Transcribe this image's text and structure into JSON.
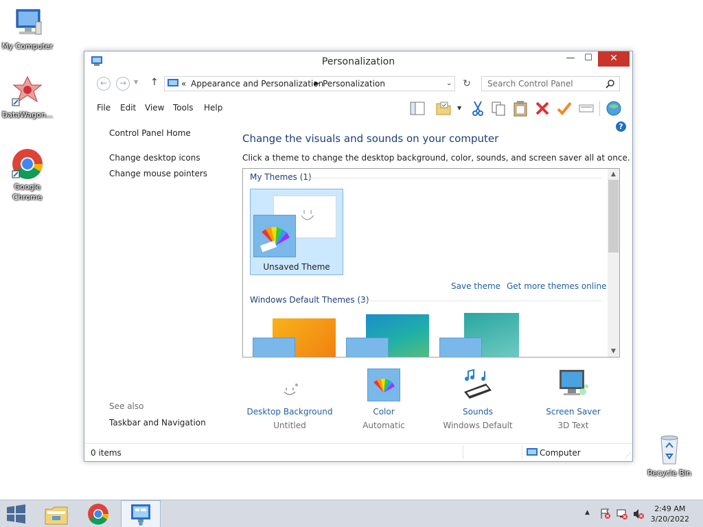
{
  "desktop": {
    "icons": [
      {
        "label": "My Computer"
      },
      {
        "label": "DataWagon..."
      },
      {
        "label": "Google Chrome"
      },
      {
        "label": "Recycle Bin"
      }
    ]
  },
  "window": {
    "title": "Personalization",
    "controls": {
      "minimize": "—",
      "maximize": "☐",
      "close": "✕"
    }
  },
  "navigation": {
    "back": "←",
    "forward": "→",
    "up": "↑",
    "breadcrumb": [
      "Appearance and Personalization",
      "Personalization"
    ],
    "breadcrumb_prefix": "«",
    "search_placeholder": "Search Control Panel"
  },
  "menu": {
    "items": [
      "File",
      "Edit",
      "View",
      "Tools",
      "Help"
    ]
  },
  "toolbar": {
    "icons": [
      "layout-icon",
      "folder-icon",
      "cut-icon",
      "copy-icon",
      "paste-icon",
      "delete-icon",
      "properties-icon",
      "rename-icon",
      "globe-icon"
    ]
  },
  "sidebar": {
    "home": "Control Panel Home",
    "links": [
      "Change desktop icons",
      "Change mouse pointers"
    ],
    "see_also_label": "See also",
    "see_also_links": [
      "Taskbar and Navigation"
    ]
  },
  "main": {
    "heading": "Change the visuals and sounds on your computer",
    "subheading": "Click a theme to change the desktop background, color, sounds, and screen saver all at once.",
    "my_themes_header": "My Themes (1)",
    "unsaved_theme_label": "Unsaved Theme",
    "save_theme": "Save theme",
    "get_more_themes": "Get more themes online",
    "default_themes_header": "Windows Default Themes (3)"
  },
  "settings": [
    {
      "title": "Desktop Background",
      "value": "Untitled"
    },
    {
      "title": "Color",
      "value": "Automatic"
    },
    {
      "title": "Sounds",
      "value": "Windows Default"
    },
    {
      "title": "Screen Saver",
      "value": "3D Text"
    }
  ],
  "status": {
    "items": "0 items",
    "location": "Computer"
  },
  "taskbar": {
    "time": "2:49 AM",
    "date": "3/20/2022"
  },
  "colors": {
    "accent_link": "#1f5fa8",
    "heading": "#1c3e7a",
    "close_button": "#c7352b",
    "selection": "#cce8ff"
  }
}
